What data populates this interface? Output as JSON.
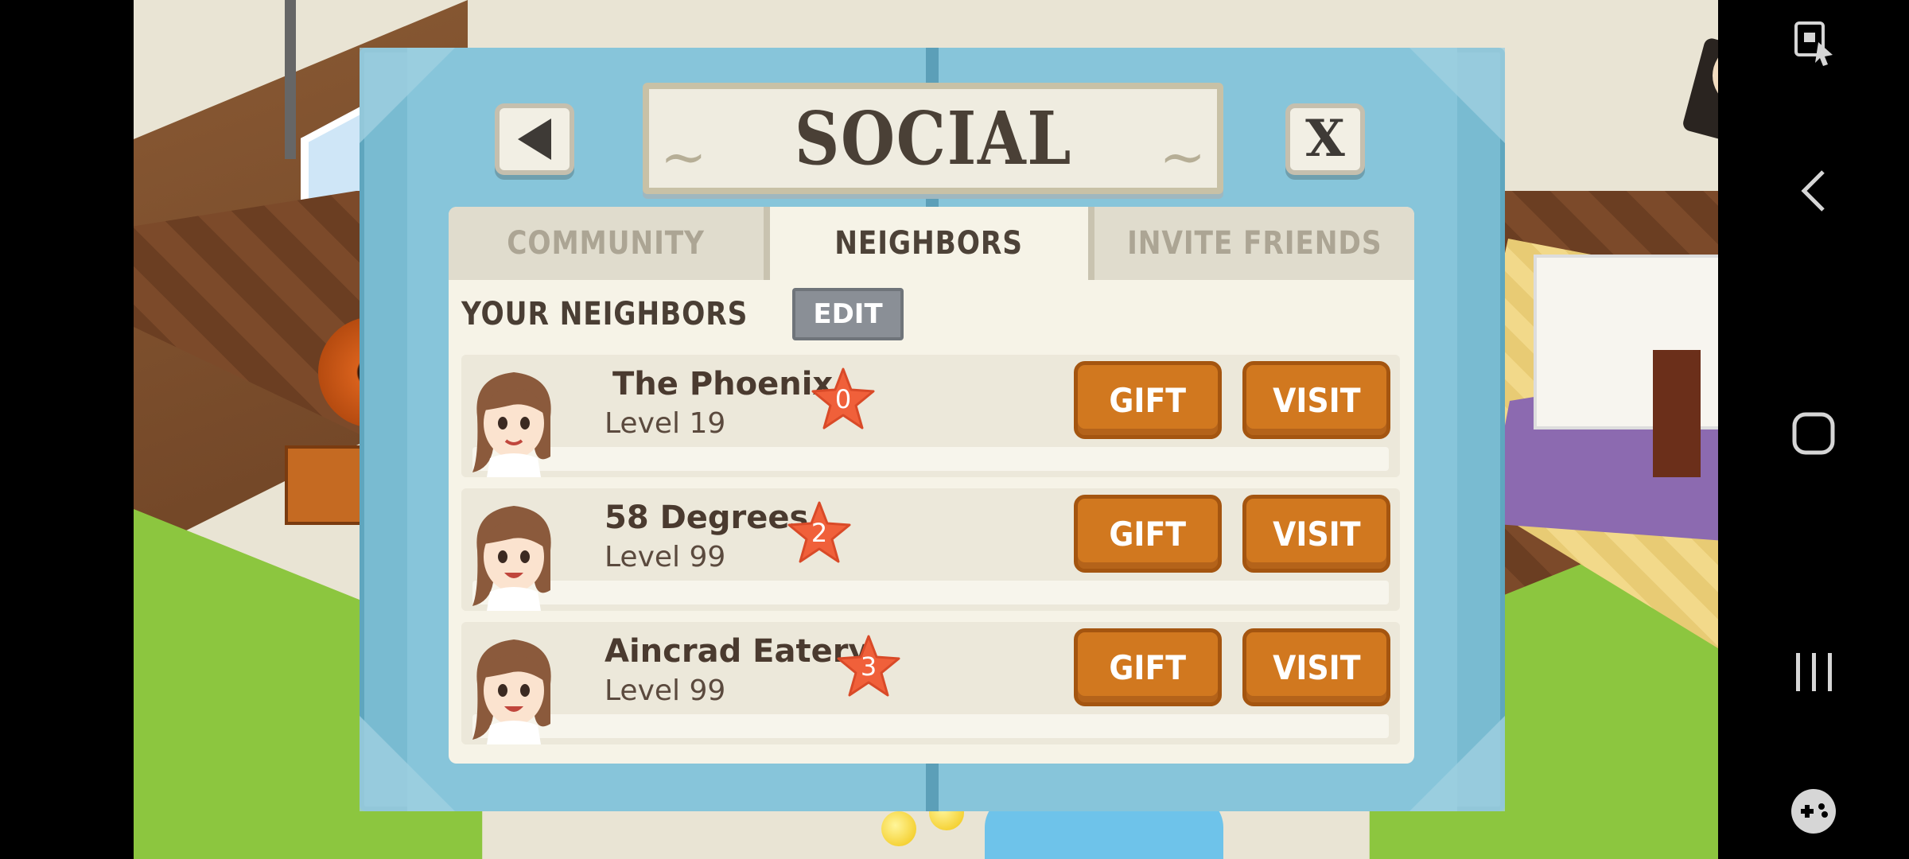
{
  "dialog": {
    "title": "SOCIAL",
    "back_icon": "back-arrow-icon",
    "close_label": "X"
  },
  "tabs": [
    {
      "label": "COMMUNITY",
      "active": false
    },
    {
      "label": "NEIGHBORS",
      "active": true
    },
    {
      "label": "INVITE FRIENDS",
      "active": false
    }
  ],
  "neighbors_section": {
    "title": "YOUR NEIGHBORS",
    "edit_label": "EDIT"
  },
  "neighbors": [
    {
      "name": "The Phoenix",
      "level": "Level 19",
      "stars": "0",
      "gift_label": "GIFT",
      "visit_label": "VISIT"
    },
    {
      "name": "58 Degrees",
      "level": "Level 99",
      "stars": "2",
      "gift_label": "GIFT",
      "visit_label": "VISIT"
    },
    {
      "name": "Aincrad Eatery",
      "level": "Level 99",
      "stars": "3",
      "gift_label": "GIFT",
      "visit_label": "VISIT"
    }
  ],
  "nav_bar": {
    "icons": [
      "screen-lock-icon",
      "back-icon",
      "home-icon",
      "recents-icon",
      "game-tools-icon"
    ]
  },
  "colors": {
    "frame": "#79bbd1",
    "panel": "#f6f3e7",
    "action_button": "#d1781f",
    "star": "#f0603a",
    "edit_button": "#8a8f96"
  }
}
